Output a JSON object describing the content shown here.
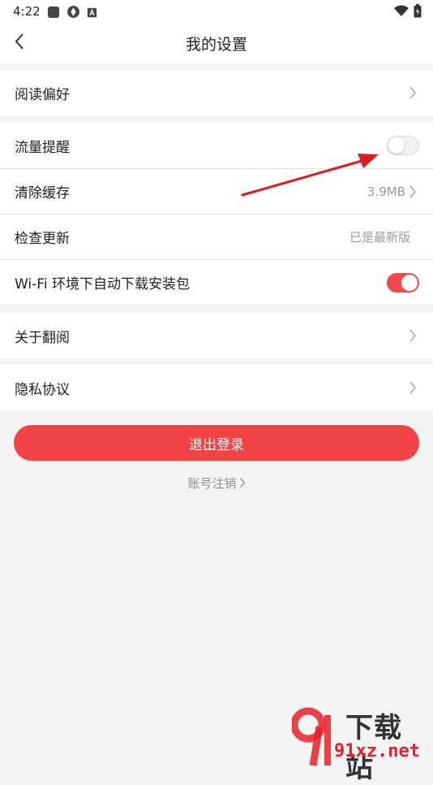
{
  "status_bar": {
    "time": "4:22"
  },
  "header": {
    "title": "我的设置"
  },
  "settings": {
    "reading_pref": "阅读偏好",
    "traffic_reminder": "流量提醒",
    "clear_cache": "清除缓存",
    "cache_size": "3.9MB",
    "check_update": "检查更新",
    "update_status": "已是最新版",
    "wifi_auto_download": "Wi-Fi 环境下自动下载安装包",
    "about": "关于翻阅",
    "privacy": "隐私协议"
  },
  "toggles": {
    "traffic_reminder_on": false,
    "wifi_auto_download_on": true
  },
  "actions": {
    "logout": "退出登录",
    "account_cancel": "账号注销"
  },
  "watermark": {
    "title": "下载站",
    "domain": "91xz.net"
  },
  "colors": {
    "accent": "#f24444",
    "annotation_arrow": "#d81e1e"
  }
}
